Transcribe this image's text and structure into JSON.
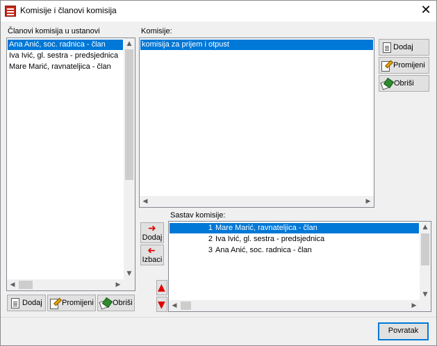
{
  "window": {
    "title": "Komisije i članovi komisija"
  },
  "members_panel": {
    "label": "Članovi komisija u ustanovi",
    "items": [
      "Ana Anić, soc. radnica - član",
      "Iva Ivić, gl. sestra - predsjednica",
      "Mare Marić, ravnateljica - član"
    ],
    "selected_index": 0,
    "buttons": {
      "add": "Dodaj",
      "edit": "Promijeni",
      "delete": "Obriši"
    }
  },
  "commissions_panel": {
    "label": "Komisije:",
    "items": [
      "komisija za prijem i otpust"
    ],
    "selected_index": 0,
    "buttons": {
      "add": "Dodaj",
      "edit": "Promijeni",
      "delete": "Obriši"
    }
  },
  "transfer": {
    "add": "Dodaj",
    "remove": "Izbaci"
  },
  "composition_panel": {
    "label": "Sastav komisije:",
    "rows": [
      {
        "num": "1",
        "text": "Mare Marić, ravnateljica - član"
      },
      {
        "num": "2",
        "text": "Iva Ivić, gl. sestra - predsjednica"
      },
      {
        "num": "3",
        "text": "Ana Anić, soc. radnica - član"
      }
    ],
    "selected_index": 0
  },
  "footer": {
    "back": "Povratak"
  },
  "icons": {
    "close": "close-icon",
    "add": "document-icon",
    "edit": "edit-document-icon",
    "delete": "eraser-icon"
  },
  "colors": {
    "selection": "#0078d7",
    "arrow": "#e00000"
  }
}
